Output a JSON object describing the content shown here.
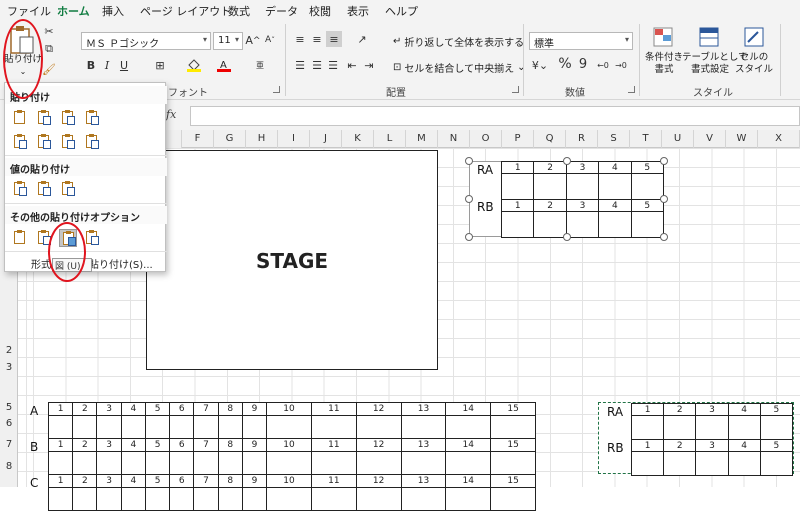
{
  "menu_tabs": [
    "ファイル",
    "ホーム",
    "挿入",
    "ページ レイアウト",
    "数式",
    "データ",
    "校閲",
    "表示",
    "ヘルプ"
  ],
  "ribbon": {
    "paste_label": "貼り付け",
    "font_name": "ＭＳ Ｐゴシック",
    "font_size": "11",
    "wrap_text": "折り返して全体を表示する",
    "merge_center": "セルを結合して中央揃え",
    "number_format": "標準",
    "group_font": "フォント",
    "group_alignment": "配置",
    "group_number": "数値",
    "group_style": "スタイル",
    "cond_format_l1": "条件付き",
    "cond_format_l2": "書式",
    "table_format_l1": "テーブルとして",
    "table_format_l2": "書式設定",
    "cell_style_l1": "セルの",
    "cell_style_l2": "スタイル",
    "bold": "B",
    "italic": "I",
    "underline": "U",
    "percent": "%",
    "comma": "9",
    "grow": "A",
    "shrink": "A",
    "phonetic": "亜"
  },
  "formula_bar": {
    "fx": "fx"
  },
  "paste_menu": {
    "section1": "貼り付け",
    "section2": "値の貼り付け",
    "section3": "その他の貼り付けオプション",
    "format_prefix": "形式",
    "tooltip": "図 (U)",
    "paste_special": "貼り付け(S)..."
  },
  "columns": [
    "F",
    "G",
    "H",
    "I",
    "J",
    "K",
    "L",
    "M",
    "N",
    "O",
    "P",
    "Q",
    "R",
    "S",
    "T",
    "U",
    "V",
    "W",
    "X"
  ],
  "rows": [
    "2",
    "3",
    "5",
    "6",
    "7",
    "8"
  ],
  "stage_label": "STAGE",
  "seats_main": {
    "numbers": [
      "1",
      "2",
      "3",
      "4",
      "5",
      "6",
      "7",
      "8",
      "9",
      "10",
      "11",
      "12",
      "13",
      "14",
      "15"
    ],
    "rows": [
      "A",
      "B",
      "C"
    ]
  },
  "seats_picture": {
    "numbers": [
      "1",
      "2",
      "3",
      "4",
      "5"
    ],
    "rows": [
      "RA",
      "RB"
    ]
  },
  "colors": {
    "accent": "#107c41",
    "highlight_circle": "#e0141e",
    "copy_border": "#217346"
  }
}
